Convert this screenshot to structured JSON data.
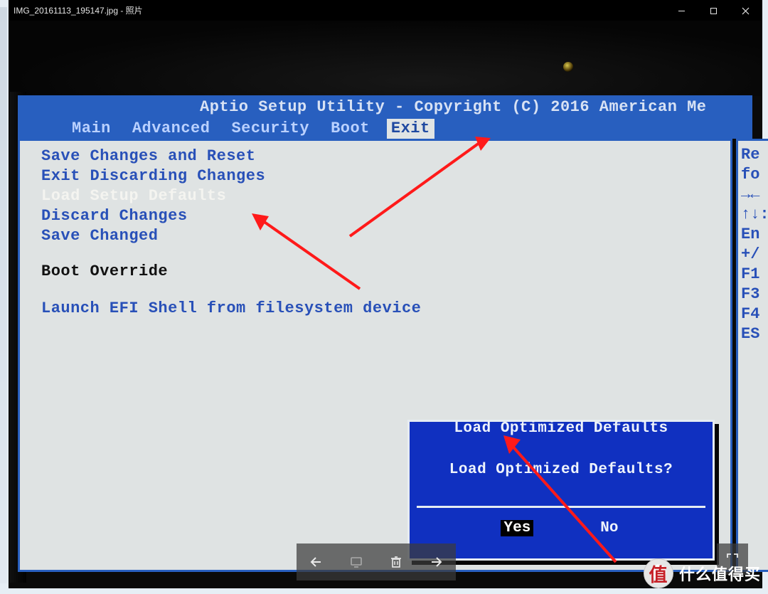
{
  "window": {
    "title": "IMG_20161113_195147.jpg - 照片",
    "controls": {
      "min": "minimize",
      "max": "maximize",
      "close": "close"
    }
  },
  "bios": {
    "header": "Aptio Setup Utility - Copyright (C) 2016 American Me",
    "tabs": [
      "Main",
      "Advanced",
      "Security",
      "Boot",
      "Exit"
    ],
    "active_tab_index": 4,
    "menu": {
      "items": [
        "Save Changes and Reset",
        "Exit Discarding Changes",
        "Load Setup Defaults",
        "Discard Changes",
        "Save Changed"
      ],
      "selected_index": 2,
      "section_label": "Boot Override",
      "efi_item": "Launch EFI Shell from filesystem device"
    },
    "help_lines": [
      "Re",
      "fo",
      "",
      "",
      "",
      "",
      "",
      "",
      "",
      "",
      "",
      "→←",
      "↑↓:",
      "En",
      "+/",
      "F1",
      "F3",
      "F4",
      "ES"
    ],
    "dialog": {
      "title": "Load Optimized Defaults",
      "message": "Load Optimized Defaults?",
      "buttons": [
        "Yes",
        "No"
      ],
      "selected_button_index": 0
    }
  },
  "viewer_toolbar": {
    "items": [
      "back",
      "comment",
      "delete",
      "next"
    ]
  },
  "watermark": {
    "badge": "值",
    "text": "什么值得买"
  }
}
